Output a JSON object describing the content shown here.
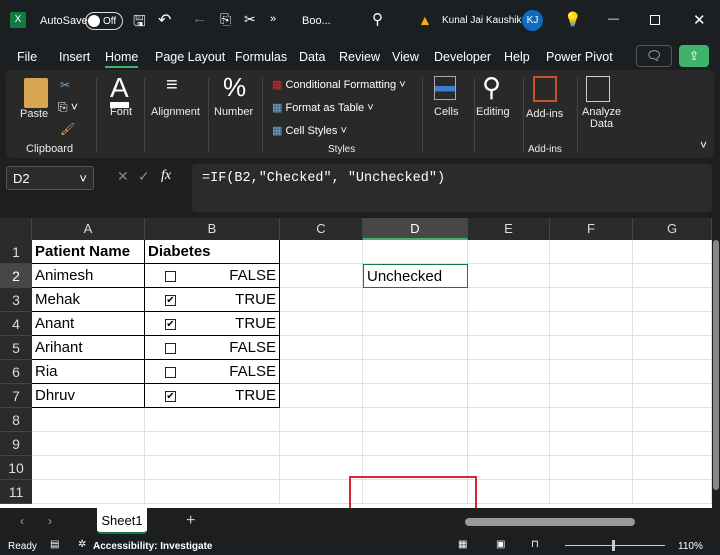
{
  "title_bar": {
    "autosave_label": "AutoSave",
    "autosave_state": "Off",
    "file_name": "Boo...",
    "user_name": "Kunal Jai Kaushik",
    "user_initials": "KJ"
  },
  "menu": [
    "File",
    "Insert",
    "Home",
    "Page Layout",
    "Formulas",
    "Data",
    "Review",
    "View",
    "Developer",
    "Help",
    "Power Pivot"
  ],
  "active_menu": "Home",
  "ribbon": {
    "paste": "Paste",
    "clipboard": "Clipboard",
    "font": "Font",
    "alignment": "Alignment",
    "number": "Number",
    "conditional_formatting": "Conditional Formatting",
    "format_as_table": "Format as Table",
    "cell_styles": "Cell Styles",
    "styles": "Styles",
    "cells": "Cells",
    "editing": "Editing",
    "addins": "Add-ins",
    "addins_group": "Add-ins",
    "analyze_data_1": "Analyze",
    "analyze_data_2": "Data"
  },
  "formula_bar": {
    "name_box": "D2",
    "fx": "fx",
    "formula": "=IF(B2,\"Checked\", \"Unchecked\")"
  },
  "columns": [
    "A",
    "B",
    "C",
    "D",
    "E",
    "F",
    "G"
  ],
  "rows": [
    "1",
    "2",
    "3",
    "4",
    "5",
    "6",
    "7",
    "8",
    "9",
    "10",
    "11"
  ],
  "headers": [
    "Patient Name",
    "Diabetes"
  ],
  "table": [
    {
      "name": "Animesh",
      "checked": false,
      "value": "FALSE"
    },
    {
      "name": "Mehak",
      "checked": true,
      "value": "TRUE"
    },
    {
      "name": "Anant",
      "checked": true,
      "value": "TRUE"
    },
    {
      "name": "Arihant",
      "checked": false,
      "value": "FALSE"
    },
    {
      "name": "Ria",
      "checked": false,
      "value": "FALSE"
    },
    {
      "name": "Dhruv",
      "checked": true,
      "value": "TRUE"
    }
  ],
  "d2_value": "Unchecked",
  "highlight_color": "#d9262c",
  "sheet_tab": "Sheet1",
  "status": {
    "ready": "Ready",
    "accessibility": "Accessibility: Investigate",
    "zoom": "110%"
  }
}
